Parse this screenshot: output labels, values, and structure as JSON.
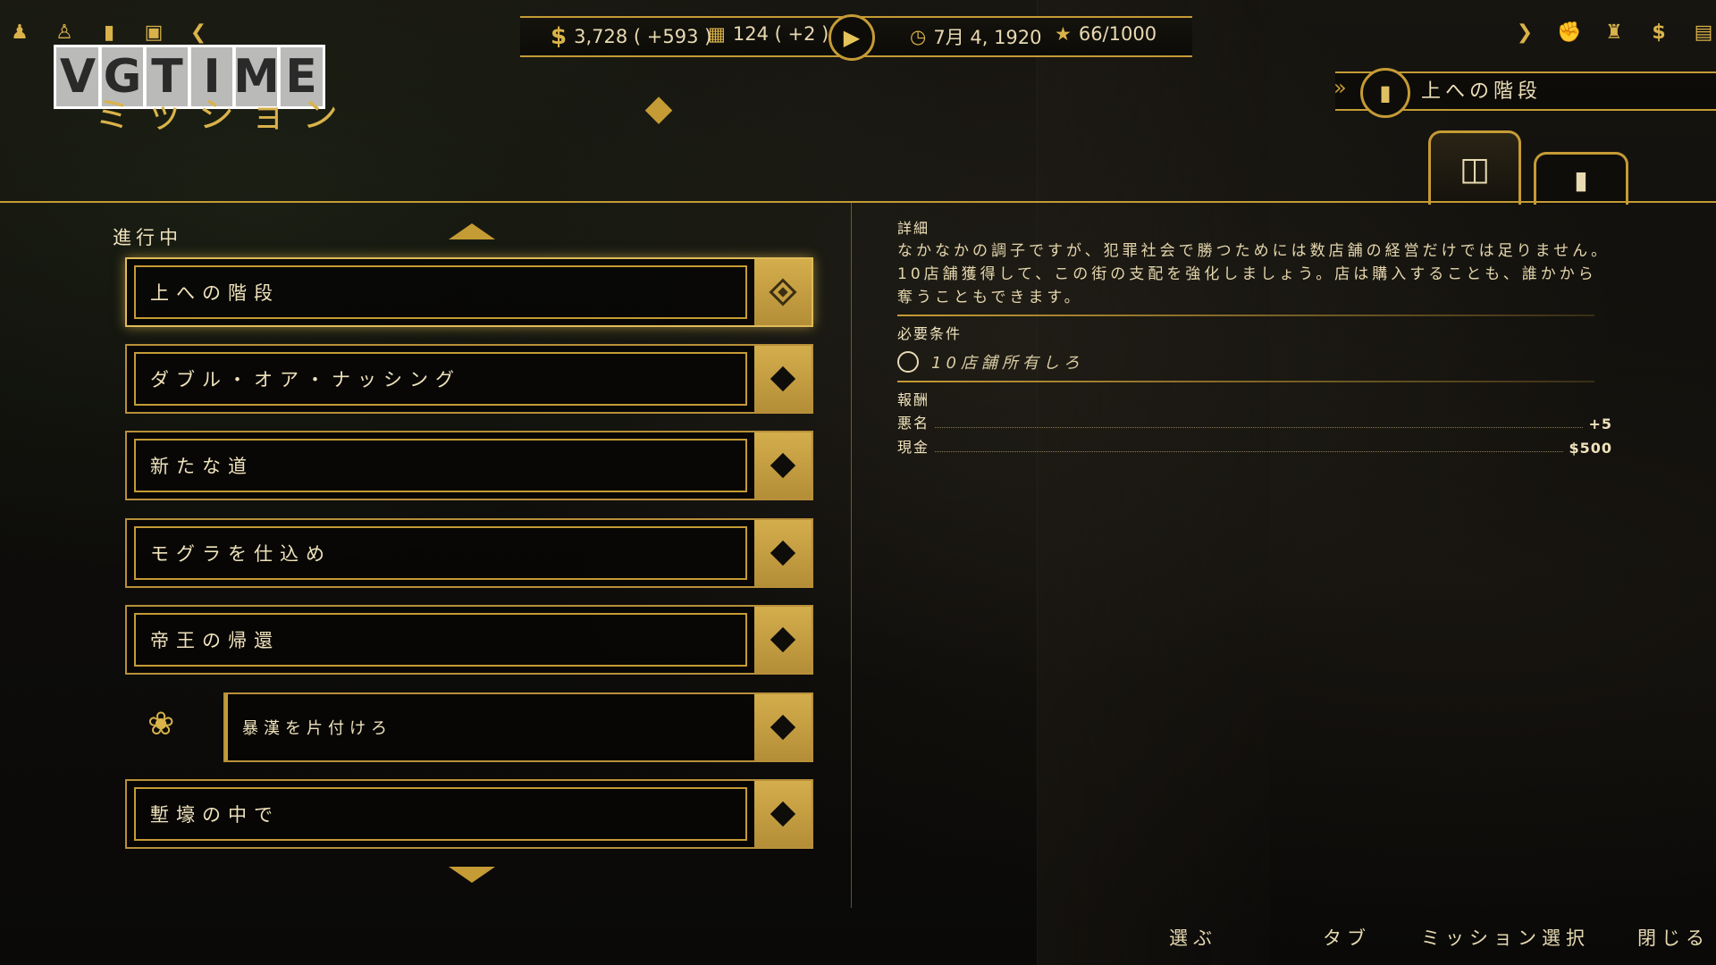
{
  "hud": {
    "cash": "3,728 ( +593 )",
    "crew": "124 ( +2 )",
    "date": "7月 4, 1920",
    "heat": "66/1000"
  },
  "watermark": "VGTIME",
  "screen_title": "ミッション",
  "banner": {
    "mission_name": "上への階段"
  },
  "left_panel": {
    "section_label": "進行中",
    "missions": [
      {
        "label": "上への階段"
      },
      {
        "label": "ダブル・オア・ナッシング"
      },
      {
        "label": "新たな道"
      },
      {
        "label": "モグラを仕込め"
      },
      {
        "label": "帝王の帰還"
      },
      {
        "label": "暴漢を片付けろ"
      },
      {
        "label": "塹壕の中で"
      }
    ]
  },
  "details": {
    "title": "詳細",
    "description": "なかなかの調子ですが、犯罪社会で勝つためには数店舗の経営だけでは足りません。10店舗獲得して、この街の支配を強化しましょう。店は購入することも、誰かから奪うこともできます。",
    "requirements_title": "必要条件",
    "requirement": "10店舗所有しろ",
    "rewards_title": "報酬",
    "rewards": [
      {
        "label": "悪名",
        "value": "+5"
      },
      {
        "label": "現金",
        "value": "$500"
      }
    ]
  },
  "hints": {
    "select": "選ぶ",
    "tab": "タブ",
    "mission_select": "ミッション選択",
    "close": "閉じる"
  }
}
